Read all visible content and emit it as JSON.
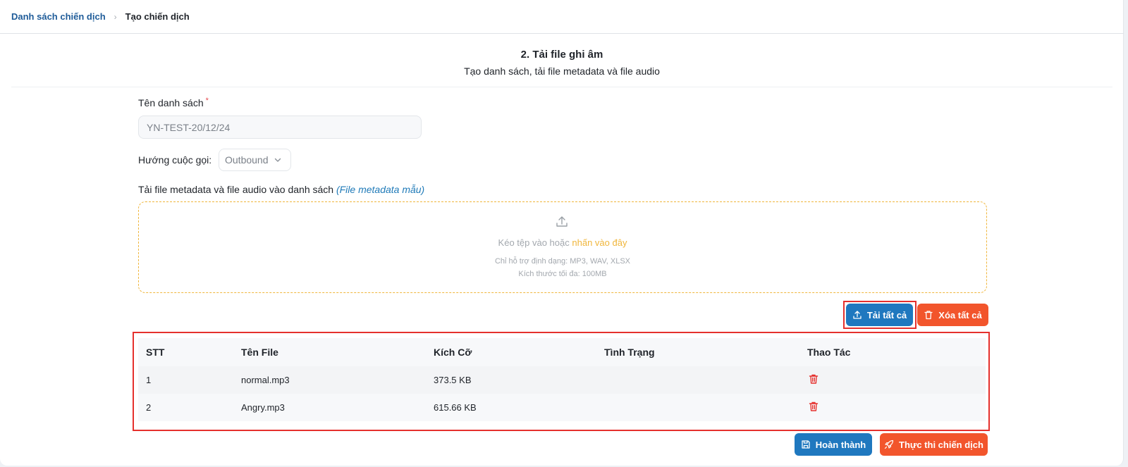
{
  "breadcrumb": {
    "parent": "Danh sách chiến dịch",
    "current": "Tạo chiến dịch"
  },
  "step": {
    "title": "2. Tải file ghi âm",
    "subtitle": "Tạo danh sách, tải file metadata và file audio"
  },
  "form": {
    "list_name_label": "Tên danh sách",
    "required_mark": "*",
    "list_name_value": "YN-TEST-20/12/24",
    "direction_label": "Hướng cuộc gọi:",
    "direction_value": "Outbound",
    "upload_label": "Tải file metadata và file audio vào danh sách",
    "template_link": "(File metadata mẫu)"
  },
  "dropzone": {
    "text": "Kéo tệp vào hoặc",
    "link": "nhấn vào đây",
    "formats": "Chỉ hỗ trợ định dạng: MP3, WAV, XLSX",
    "max_size": "Kích thước tối đa: 100MB"
  },
  "actions": {
    "upload_all": "Tải tất cả",
    "delete_all": "Xóa tất cả",
    "finish": "Hoàn thành",
    "run_campaign": "Thực thi chiến dịch"
  },
  "table": {
    "headers": [
      "STT",
      "Tên File",
      "Kích Cỡ",
      "Tình Trạng",
      "Thao Tác"
    ],
    "rows": [
      {
        "stt": "1",
        "name": "normal.mp3",
        "size": "373.5 KB",
        "status": ""
      },
      {
        "stt": "2",
        "name": "Angry.mp3",
        "size": "615.66 KB",
        "status": ""
      }
    ]
  },
  "colors": {
    "primary": "#1f78bf",
    "danger": "#f2552c",
    "dropzone_border": "#f0b63c",
    "highlight": "#e5302d"
  },
  "icons": [
    "chevron-right-icon",
    "chevron-down-icon",
    "upload-icon",
    "trash-icon",
    "save-icon",
    "rocket-icon"
  ]
}
